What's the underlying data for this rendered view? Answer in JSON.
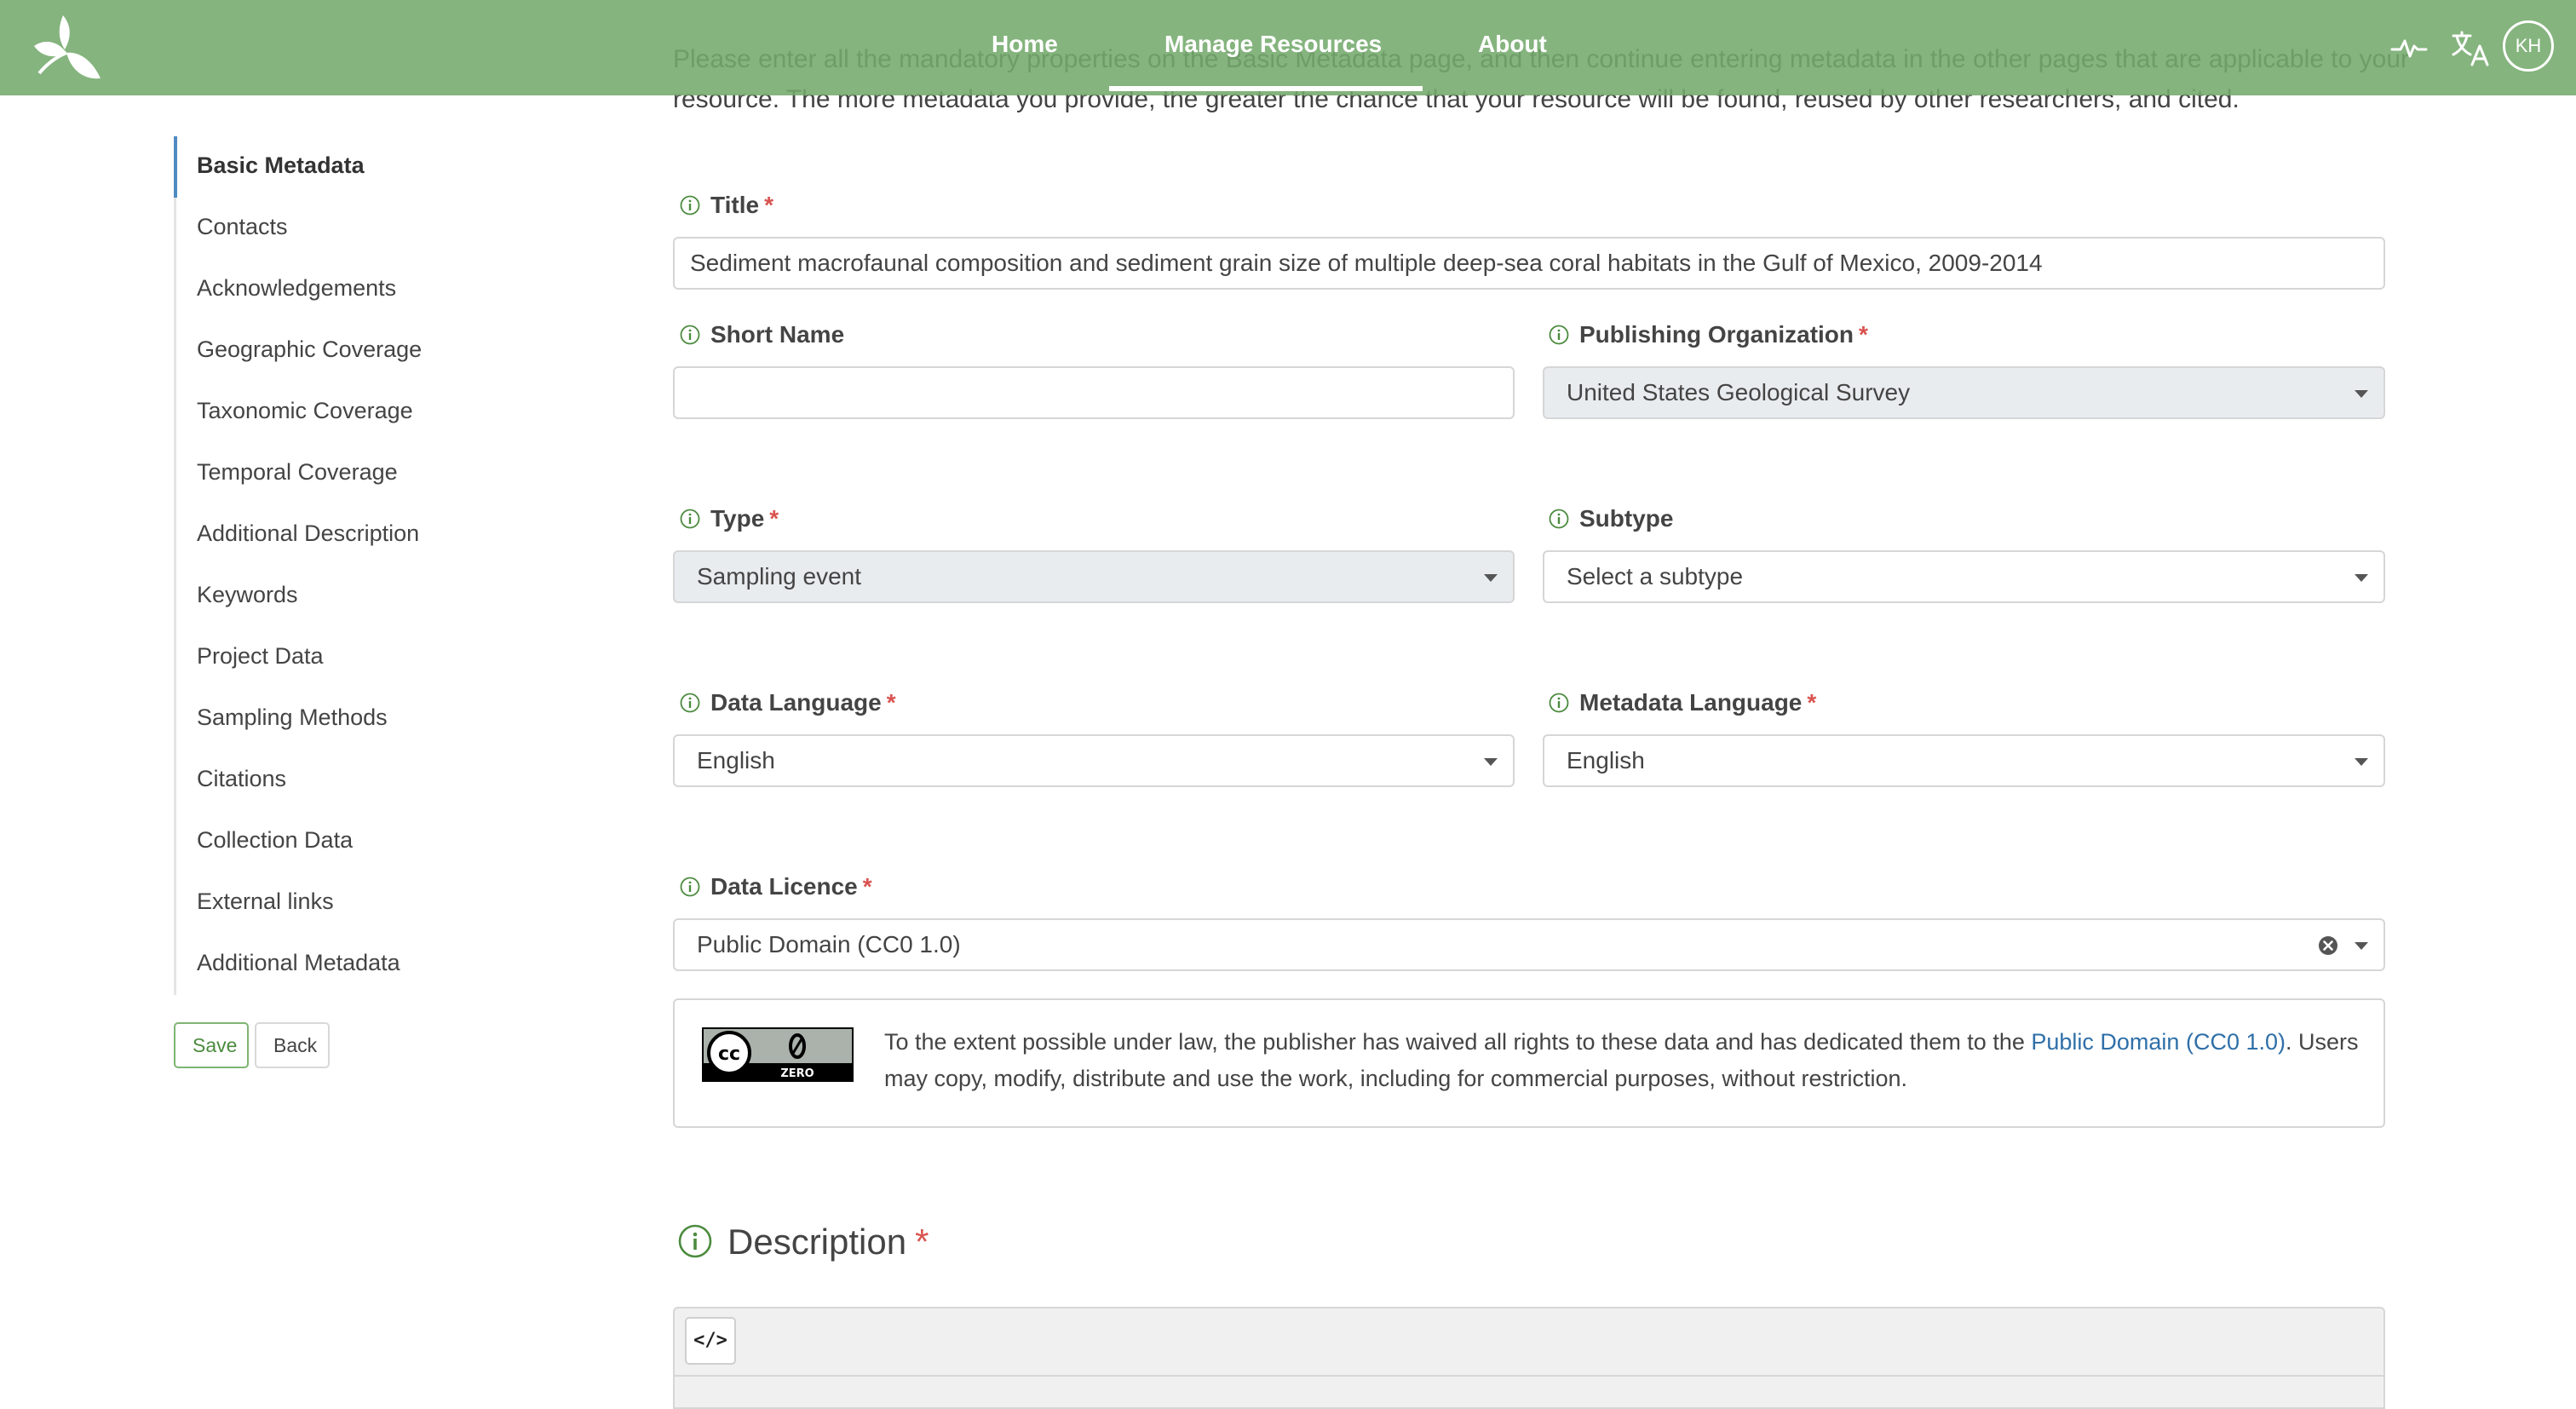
{
  "nav": {
    "items": [
      "Home",
      "Manage Resources",
      "About"
    ],
    "active": "Manage Resources",
    "avatar_initials": "KH"
  },
  "intro": "Please enter all the mandatory properties on the Basic Metadata page, and then continue entering metadata in the other pages that are applicable to your resource. The more metadata you provide, the greater the chance that your resource will be found, reused by other researchers, and cited.",
  "sidebar": {
    "items": [
      {
        "label": "Basic Metadata",
        "active": true
      },
      {
        "label": "Contacts"
      },
      {
        "label": "Acknowledgements"
      },
      {
        "label": "Geographic Coverage"
      },
      {
        "label": "Taxonomic Coverage"
      },
      {
        "label": "Temporal Coverage"
      },
      {
        "label": "Additional Description"
      },
      {
        "label": "Keywords"
      },
      {
        "label": "Project Data"
      },
      {
        "label": "Sampling Methods"
      },
      {
        "label": "Citations"
      },
      {
        "label": "Collection Data"
      },
      {
        "label": "External links"
      },
      {
        "label": "Additional Metadata"
      }
    ],
    "save_label": "Save",
    "back_label": "Back"
  },
  "form": {
    "required_mark": "*",
    "title": {
      "label": "Title",
      "value": "Sediment macrofaunal composition and sediment grain size of multiple deep-sea coral habitats in the Gulf of Mexico, 2009-2014"
    },
    "short_name": {
      "label": "Short Name",
      "value": ""
    },
    "publishing_org": {
      "label": "Publishing Organization",
      "value": "United States Geological Survey"
    },
    "type": {
      "label": "Type",
      "value": "Sampling event"
    },
    "subtype": {
      "label": "Subtype",
      "placeholder": "Select a subtype"
    },
    "data_language": {
      "label": "Data Language",
      "value": "English"
    },
    "metadata_language": {
      "label": "Metadata Language",
      "value": "English"
    },
    "data_licence": {
      "label": "Data Licence",
      "value": "Public Domain (CC0 1.0)"
    },
    "licence_info": {
      "text_before": "To the extent possible under law, the publisher has waived all rights to these data and has dedicated them to the ",
      "link": "Public Domain (CC0 1.0)",
      "text_after": ". Users may copy, modify, distribute and use the work, including for commercial purposes, without restriction.",
      "badge_text": "ZERO"
    },
    "description": {
      "label": "Description",
      "code_button": "</>"
    }
  },
  "colors": {
    "topbar": "#74aa6c",
    "required": "#d9534f",
    "link": "#2f6fa8",
    "sidebar_active": "#4e8ac1"
  }
}
